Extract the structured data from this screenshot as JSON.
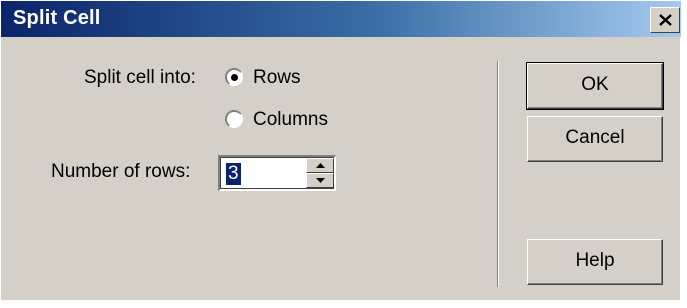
{
  "window": {
    "title": "Split Cell"
  },
  "split": {
    "label": "Split cell into:",
    "options": [
      {
        "label": "Rows",
        "selected": true
      },
      {
        "label": "Columns",
        "selected": false
      }
    ]
  },
  "count": {
    "label": "Number of rows:",
    "value": "3"
  },
  "buttons": {
    "ok": "OK",
    "cancel": "Cancel",
    "help": "Help"
  },
  "colors": {
    "title_start": "#0a246a",
    "title_end": "#a6caf0",
    "face": "#d4d0c8"
  }
}
